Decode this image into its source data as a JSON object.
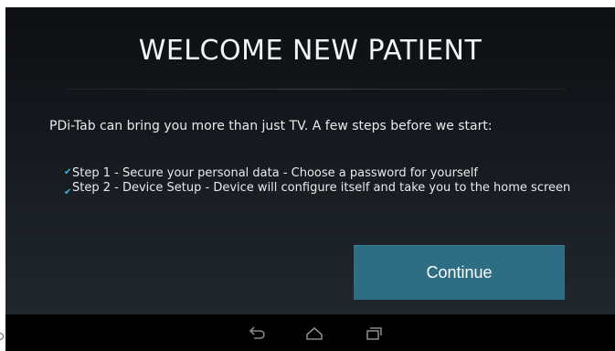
{
  "welcome": {
    "title": "WELCOME NEW PATIENT",
    "intro": "PDi-Tab can bring you more than just TV. A few steps before we start:"
  },
  "steps": [
    {
      "label": "Step 1 - Secure your personal data - Choose a password for yourself",
      "icon": "check-icon"
    },
    {
      "label": "Step 2 - Device Setup - Device will configure itself and take you to the home screen",
      "icon": "check-icon"
    }
  ],
  "actions": {
    "continue_label": "Continue"
  },
  "navigation": {
    "icons": [
      "back-icon",
      "home-icon",
      "recent-apps-icon"
    ]
  },
  "colors": {
    "accent": "#3db7e6",
    "button": "#2e6e84",
    "background_top": "#0d0f12",
    "background_bottom": "#232a31"
  }
}
